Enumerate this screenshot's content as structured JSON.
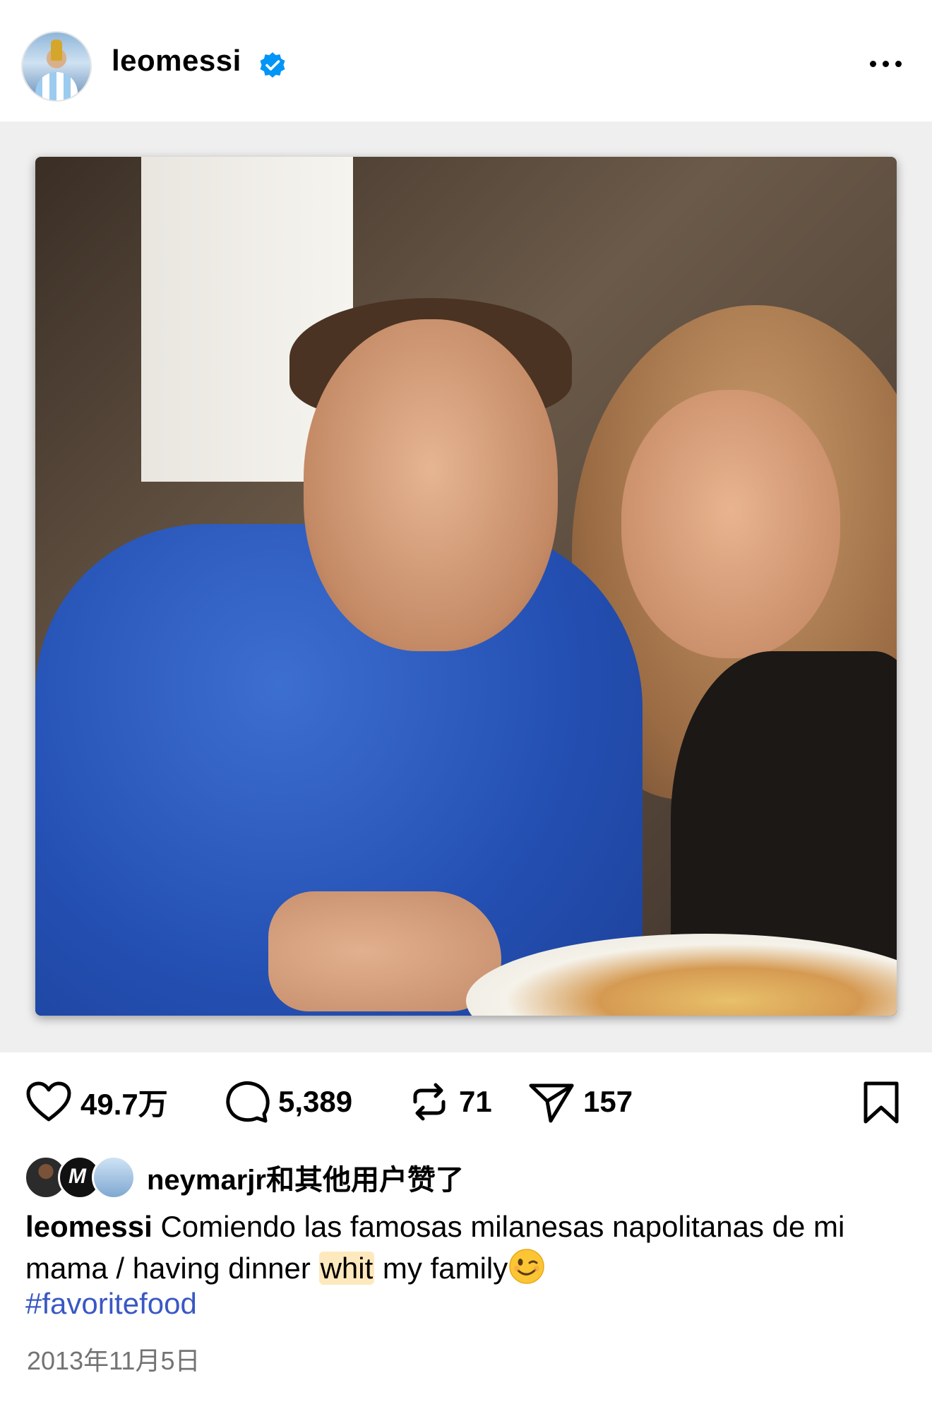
{
  "post": {
    "username": "leomessi",
    "verified": true,
    "more_icon": "ellipsis-icon",
    "image_alt": "Photo of two people at a dinner table with a plate of food"
  },
  "actions": {
    "likes": "49.7万",
    "comments": "5,389",
    "reposts": "71",
    "shares": "157"
  },
  "liked_by": {
    "text": "neymarjr和其他用户赞了"
  },
  "caption": {
    "username": "leomessi",
    "text_part1": "Comiendo las famosas milanesas napolitanas de mi mama / having dinner ",
    "highlight": "whit",
    "text_part2": " my family",
    "hashtag": "#favoritefood"
  },
  "date": "2013年11月5日",
  "colors": {
    "verified_blue": "#0095f6",
    "hashtag_blue": "#3a58c4",
    "highlight": "#fde9bd",
    "secondary_text": "#737373"
  }
}
